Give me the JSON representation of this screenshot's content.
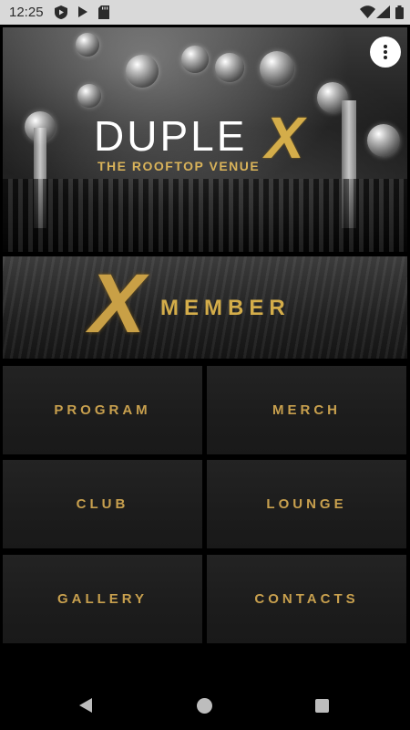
{
  "status_bar": {
    "time": "12:25",
    "icons": [
      "play-protect-icon",
      "play-icon",
      "sd-card-icon",
      "wifi-icon",
      "signal-icon",
      "battery-icon"
    ]
  },
  "hero": {
    "brand_main": "DUPLE",
    "brand_x": "X",
    "tagline": "THE ROOFTOP VENUE",
    "menu_icon": "more-vert-icon"
  },
  "member_banner": {
    "x_mark": "X",
    "label": "MEMBER"
  },
  "tiles": [
    {
      "label": "PROGRAM"
    },
    {
      "label": "MERCH"
    },
    {
      "label": "CLUB"
    },
    {
      "label": "LOUNGE"
    },
    {
      "label": "GALLERY"
    },
    {
      "label": "CONTACTS"
    }
  ],
  "colors": {
    "accent_gold": "#c8a04e",
    "tile_bg": "#1e1e1e",
    "background": "#000000"
  },
  "nav_bar": {
    "icons": [
      "back-icon",
      "home-icon",
      "recents-icon"
    ]
  }
}
